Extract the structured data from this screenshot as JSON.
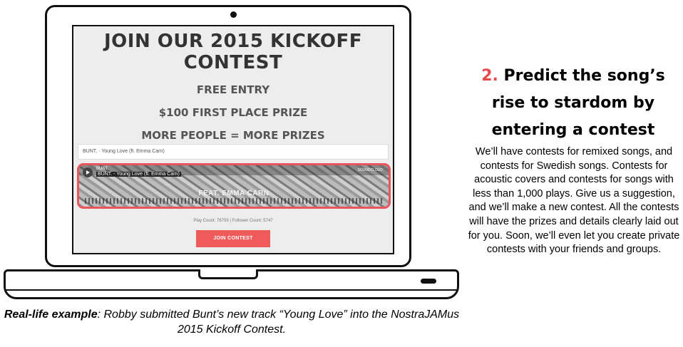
{
  "screen": {
    "title": "JOIN OUR 2015 KICKOFF CONTEST",
    "line1": "FREE ENTRY",
    "line2": "$100 FIRST PLACE PRIZE",
    "line3": "MORE PEOPLE = MORE PRIZES",
    "track_header": "BUNT. · Young Love (ft. Emma Carn)",
    "player": {
      "artist": "BUNT.",
      "track": "BUNT. - Young Love (ft. Emma Carn)",
      "soundcloud": "SOUNDCLOUD",
      "feat": "FEAT. EMMA CARN"
    },
    "stats": "Play Count: 76759  |  Follower Count: 5747",
    "join_button": "JOIN CONTEST"
  },
  "caption": {
    "bold": "Real-life example",
    "text": ": Robby submitted Bunt’s new track “Young Love” into the NostraJAMus 2015 Kickoff Contest."
  },
  "panel": {
    "number": "2.",
    "headline": "Predict the song’s rise to stardom by entering a contest",
    "body": "We’ll have contests for remixed songs, and contests for Swedish songs. Contests for acoustic covers and contests for songs with less than 1,000 plays. Give us a suggestion, and we’ll make a new contest. All the contests will have the prizes and details clearly laid out for you. Soon, we’ll even let you create private contests with your friends and groups."
  },
  "colors": {
    "accent": "#e8474c",
    "button": "#ef5a5a"
  }
}
